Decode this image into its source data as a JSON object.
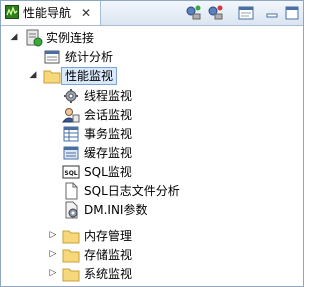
{
  "tab": {
    "title": "性能导航",
    "close": "✕"
  },
  "toolbar": [
    {
      "name": "toolbar-connect-button",
      "icon": "connect-icon"
    },
    {
      "name": "toolbar-disconnect-button",
      "icon": "disconnect-icon"
    },
    {
      "name": "toolbar-view-button",
      "icon": "view-icon"
    },
    {
      "name": "toolbar-minimize-button",
      "icon": "minimize-icon"
    },
    {
      "name": "toolbar-maximize-button",
      "icon": "maximize-icon"
    }
  ],
  "tree": {
    "root": {
      "label": "实例连接",
      "icon": "server-instance-icon"
    },
    "stats": {
      "label": "统计分析",
      "icon": "statistics-icon"
    },
    "perf": {
      "label": "性能监视",
      "icon": "folder-icon"
    },
    "perf_children": [
      {
        "label": "线程监视",
        "icon": "thread-gear-icon"
      },
      {
        "label": "会话监视",
        "icon": "session-user-icon"
      },
      {
        "label": "事务监视",
        "icon": "transaction-table-icon"
      },
      {
        "label": "缓存监视",
        "icon": "cache-icon"
      },
      {
        "label": "SQL监视",
        "icon": "sql-icon"
      },
      {
        "label": "SQL日志文件分析",
        "icon": "document-icon"
      },
      {
        "label": "DM.INI参数",
        "icon": "ini-params-icon"
      }
    ],
    "memory": {
      "label": "内存管理",
      "icon": "folder-icon"
    },
    "storage": {
      "label": "存储监视",
      "icon": "folder-icon"
    },
    "system": {
      "label": "系统监视",
      "icon": "folder-icon"
    }
  }
}
